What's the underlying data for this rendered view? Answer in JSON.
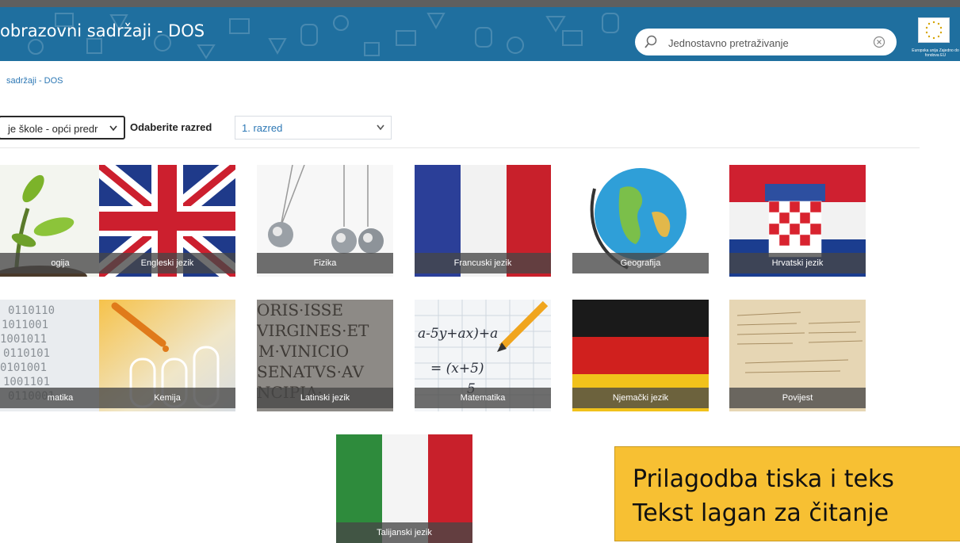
{
  "header": {
    "title": "obrazovni sadržaji - DOS",
    "search_placeholder": "Jednostavno pretraživanje",
    "eu_logo_text": "Europska unija Zajedno do fondova EU"
  },
  "breadcrumb": "sadržaji - DOS",
  "filters": {
    "school_select_value": "je škole - opći predr",
    "grade_label": "Odaberite razred",
    "grade_select_value": "1. razred"
  },
  "subjects": [
    {
      "label": "ogija"
    },
    {
      "label": "Engleski jezik"
    },
    {
      "label": "Fizika"
    },
    {
      "label": "Francuski jezik"
    },
    {
      "label": "Geografija"
    },
    {
      "label": "Hrvatski jezik"
    },
    {
      "label": "matika"
    },
    {
      "label": "Kemija"
    },
    {
      "label": "Latinski jezik"
    },
    {
      "label": "Matematika"
    },
    {
      "label": "Njemački jezik"
    },
    {
      "label": "Povijest"
    },
    {
      "label": "Talijanski jezik"
    }
  ],
  "callout": {
    "line1": "Prilagodba tiska i teks",
    "line2": "Tekst lagan za čitanje"
  },
  "colors": {
    "header_bg": "#1f6f9f",
    "link": "#2d78b5",
    "callout_bg": "#f7c033"
  },
  "icons": [
    "search-icon",
    "clear-icon",
    "chevron-down-icon",
    "eu-flag-icon"
  ]
}
